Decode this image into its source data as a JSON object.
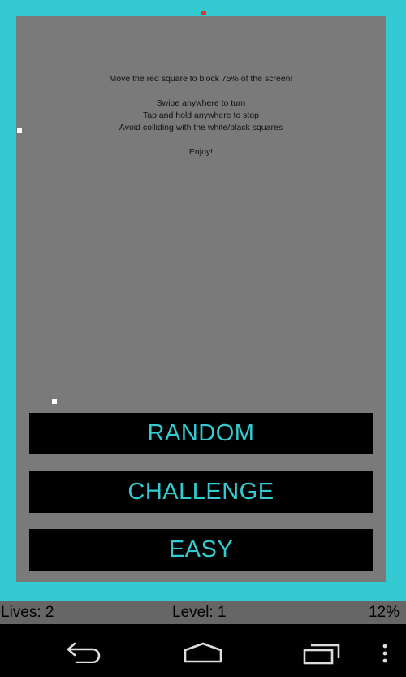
{
  "instructions": [
    "Move the red square to block 75% of the screen!",
    "",
    "Swipe anywhere to turn",
    "Tap and hold anywhere to stop",
    "Avoid colliding with the white/black squares",
    "",
    "Enjoy!"
  ],
  "buttons": {
    "random": "RANDOM",
    "challenge": "CHALLENGE",
    "easy": "EASY"
  },
  "status": {
    "lives": "Lives: 2",
    "level": "Level: 1",
    "percent": "12%"
  },
  "colors": {
    "border": "#33cbd1",
    "board": "#7a7a7a",
    "player": "#e53333",
    "enemy": "#ffffff",
    "button_text": "#33cbd1"
  },
  "navbar": {
    "icons": [
      "back-icon",
      "home-icon",
      "recent-apps-icon",
      "overflow-menu-icon"
    ]
  }
}
